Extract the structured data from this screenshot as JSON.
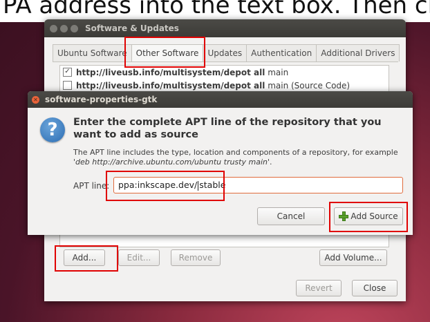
{
  "caption": {
    "text": "PA address into the text box. Then click Ad"
  },
  "sw_window": {
    "title": "Software & Updates",
    "tabs": [
      {
        "label": "Ubuntu Software"
      },
      {
        "label": "Other Software"
      },
      {
        "label": "Updates"
      },
      {
        "label": "Authentication"
      },
      {
        "label": "Additional Drivers"
      }
    ],
    "repos": [
      {
        "url": "http://liveusb.info/multisystem/depot all",
        "suffix": "main",
        "checked": true
      },
      {
        "url": "http://liveusb.info/multisystem/depot all",
        "suffix": "main (Source Code)",
        "checked": false
      }
    ],
    "buttons": {
      "add": "Add...",
      "edit": "Edit...",
      "remove": "Remove",
      "add_volume": "Add Volume...",
      "revert": "Revert",
      "close": "Close"
    }
  },
  "dialog": {
    "title": "software-properties-gtk",
    "heading": "Enter the complete APT line of the repository that you want to add as source",
    "description_prefix": "The APT line includes the type, location and components of a repository, for example  '",
    "description_example": "deb http://archive.ubuntu.com/ubuntu trusty main",
    "description_suffix": "'.",
    "apt_label": "APT line:",
    "apt_value_before_caret": "ppa:inkscape.dev/",
    "apt_value_after_caret": "stable",
    "cancel": "Cancel",
    "add_source": "Add Source"
  },
  "colors": {
    "highlight": "#e00000",
    "input_focus": "#e06a3b",
    "titlebar": "#3c3b37"
  }
}
